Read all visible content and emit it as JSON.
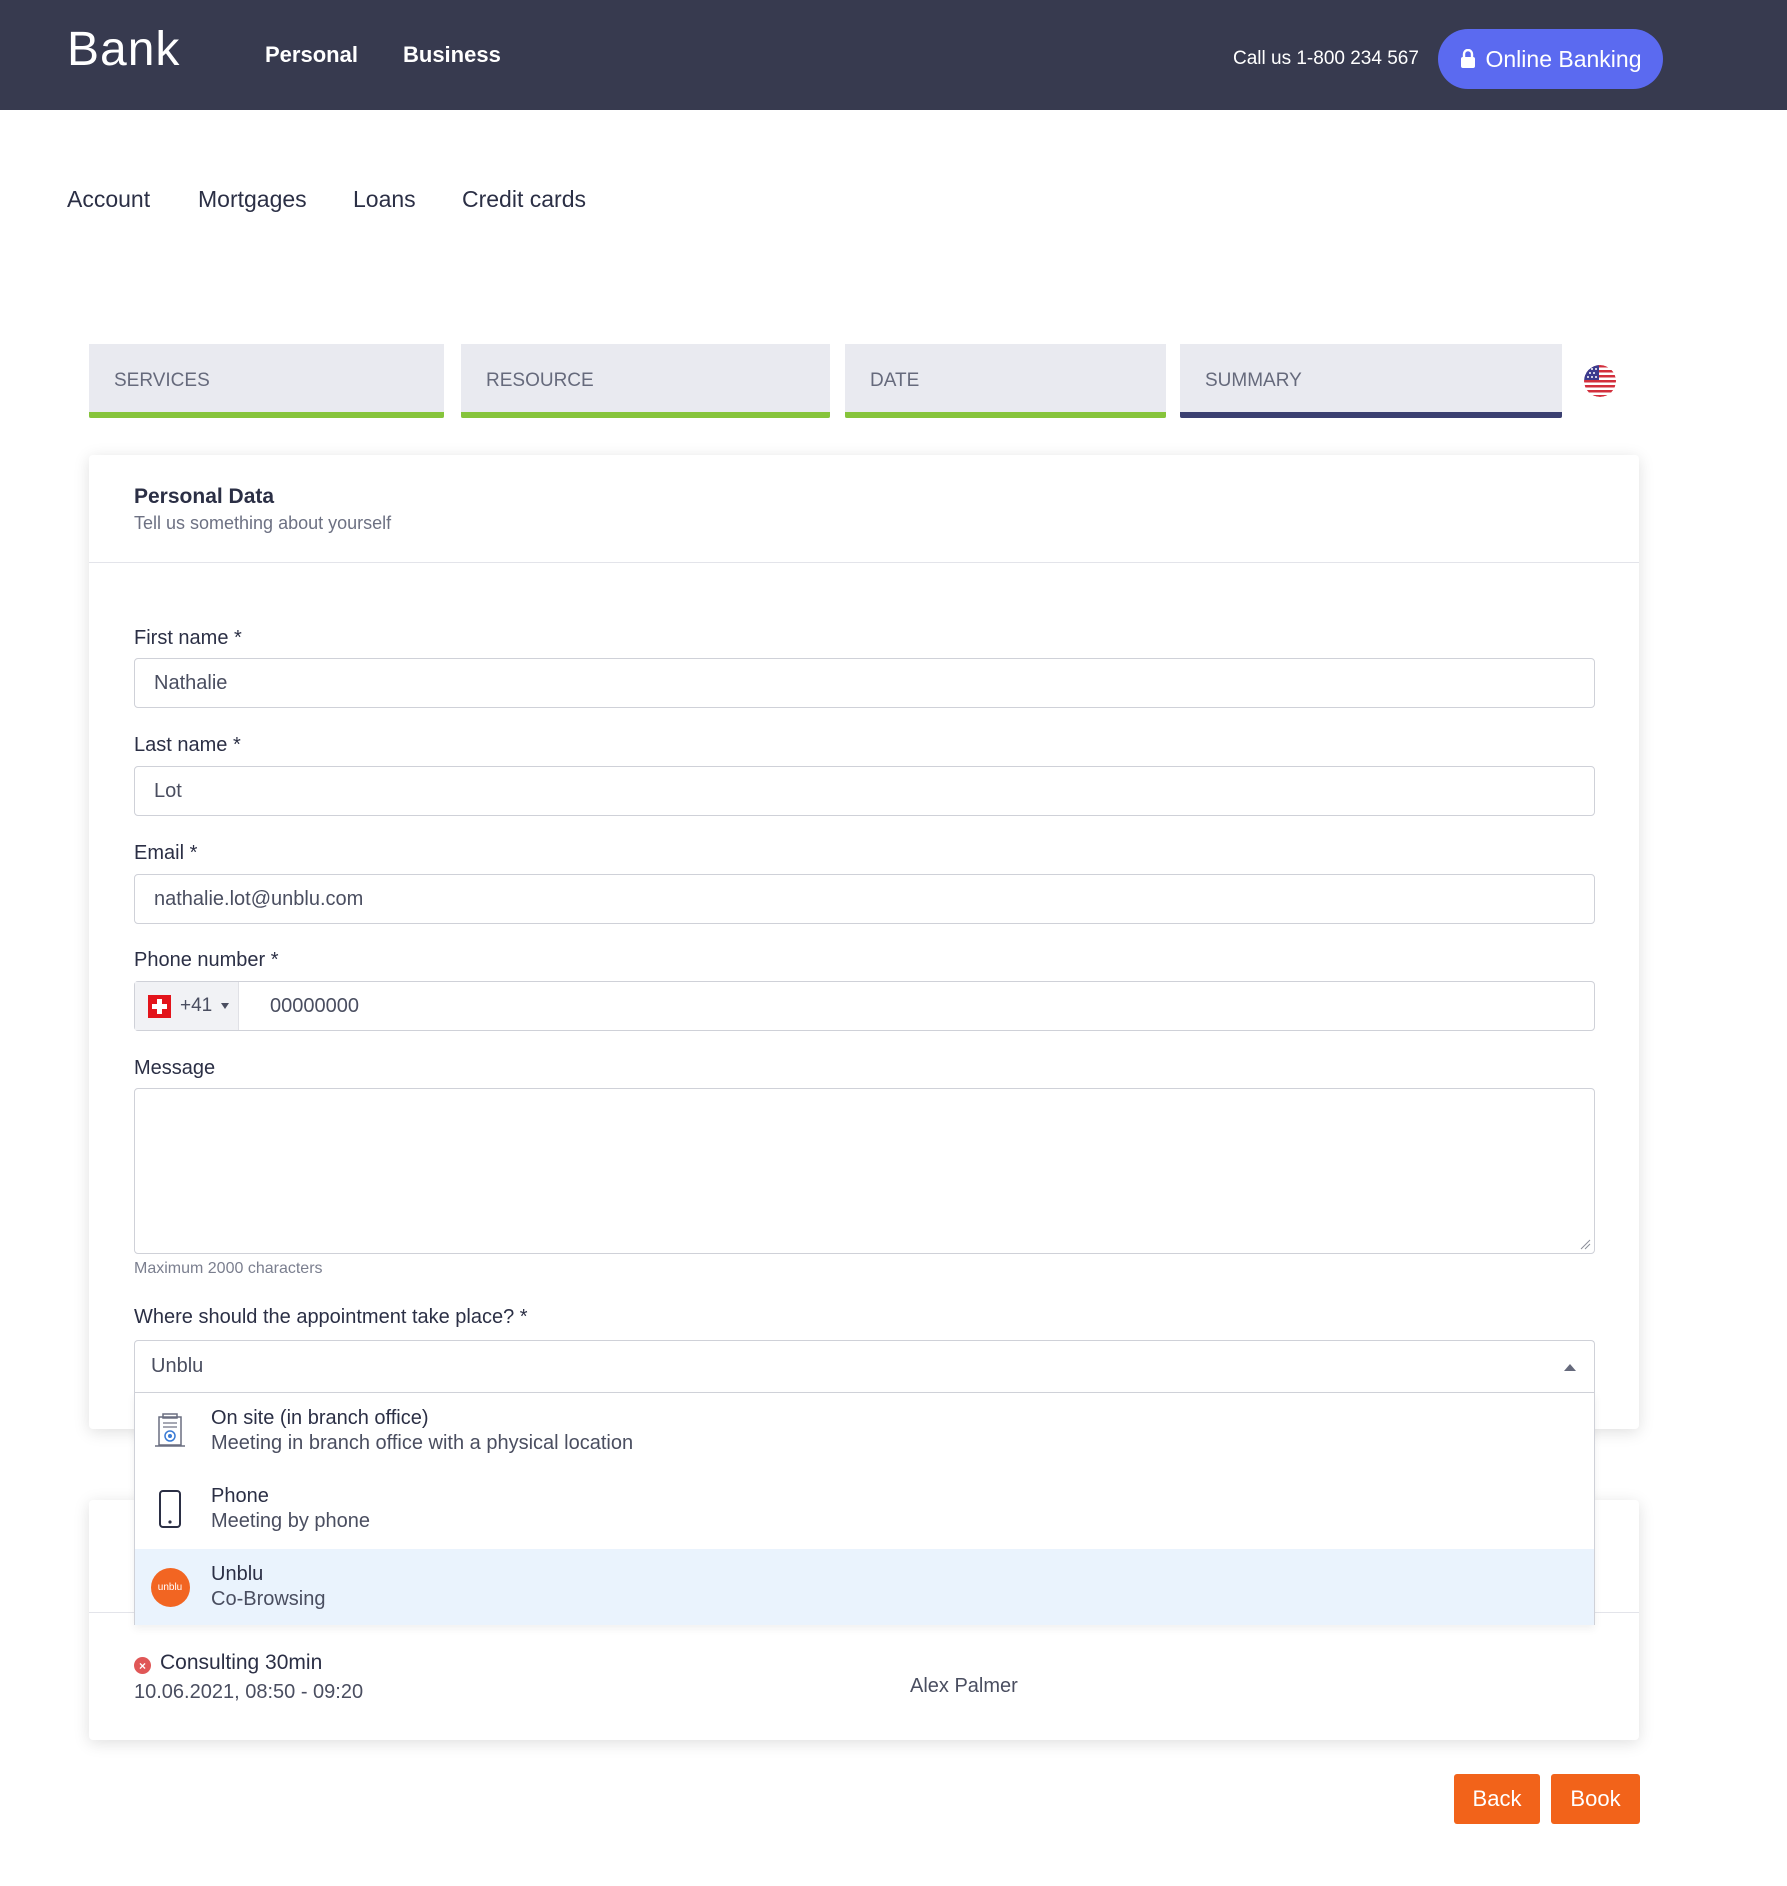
{
  "header": {
    "brand": "Bank",
    "nav": [
      "Personal",
      "Business"
    ],
    "call": "Call us 1-800 234 567",
    "online_banking": "Online Banking",
    "bg_color": "#373a4f",
    "accent_color": "#5b6af0"
  },
  "subnav": [
    "Account",
    "Mortgages",
    "Loans",
    "Credit cards"
  ],
  "steps": [
    {
      "label": "SERVICES",
      "status": "completed"
    },
    {
      "label": "RESOURCE",
      "status": "completed"
    },
    {
      "label": "DATE",
      "status": "completed"
    },
    {
      "label": "SUMMARY",
      "status": "active"
    }
  ],
  "language_flag": "us-flag-icon",
  "personal_data": {
    "title": "Personal Data",
    "subtitle": "Tell us something about yourself",
    "first_name_label": "First name *",
    "first_name_value": "Nathalie",
    "last_name_label": "Last name *",
    "last_name_value": "Lot",
    "email_label": "Email *",
    "email_value": "nathalie.lot@unblu.com",
    "phone_label": "Phone number *",
    "phone_country_code": "+41",
    "phone_value": "00000000",
    "message_label": "Message",
    "message_value": "",
    "message_hint": "Maximum 2000 characters",
    "location_label": "Where should the appointment take place? *",
    "location_value": "Unblu",
    "location_options": [
      {
        "title": "On site (in branch office)",
        "description": "Meeting in branch office with a physical location",
        "icon": "branch-office-icon"
      },
      {
        "title": "Phone",
        "description": "Meeting by phone",
        "icon": "phone-icon"
      },
      {
        "title": "Unblu",
        "description": "Co-Browsing",
        "icon": "unblu-logo-icon",
        "logo_text": "unblu",
        "selected": true
      }
    ]
  },
  "appointment": {
    "service": "Consulting 30min",
    "datetime": "10.06.2021, 08:50 - 09:20",
    "resource": "Alex Palmer"
  },
  "buttons": {
    "back": "Back",
    "book": "Book",
    "color": "#f2631a"
  }
}
